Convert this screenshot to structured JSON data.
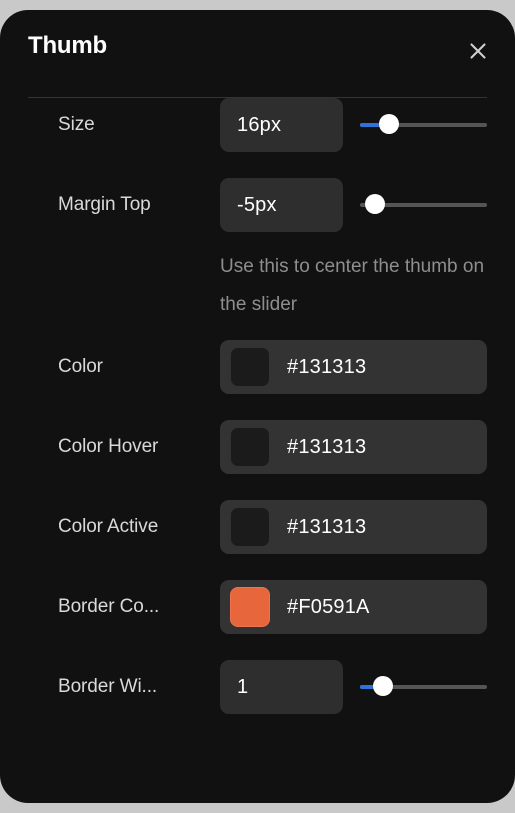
{
  "panel": {
    "title": "Thumb",
    "close_icon": "close-icon",
    "background": "#111111"
  },
  "theme": {
    "accent_blue": "#2f73d8",
    "field_bg": "#2e2e2e",
    "color_field_bg": "#333333",
    "label_color": "#d9d9d9",
    "hint_color": "#8e8e8e",
    "track_color": "#555555",
    "thumb_color": "#ffffff"
  },
  "fields": {
    "size": {
      "label": "Size",
      "value": "16px",
      "slider": {
        "fill_percent": 23,
        "thumb_percent": 23
      }
    },
    "margin_top": {
      "label": "Margin Top",
      "value": "-5px",
      "slider": {
        "fill_percent": 0,
        "thumb_percent": 12
      },
      "hint": "Use this to center the thumb on the slider"
    },
    "color": {
      "label": "Color",
      "hex": "#131313",
      "swatch": "#1b1b1b"
    },
    "color_hover": {
      "label": "Color Hover",
      "hex": "#131313",
      "swatch": "#1b1b1b"
    },
    "color_active": {
      "label": "Color Active",
      "hex": "#131313",
      "swatch": "#1b1b1b"
    },
    "border_color": {
      "label": "Border Co...",
      "hex": "#F0591A",
      "swatch": "#e8663c"
    },
    "border_width": {
      "label": "Border Wi...",
      "value": "1",
      "slider": {
        "fill_percent": 17,
        "thumb_percent": 18
      }
    }
  }
}
